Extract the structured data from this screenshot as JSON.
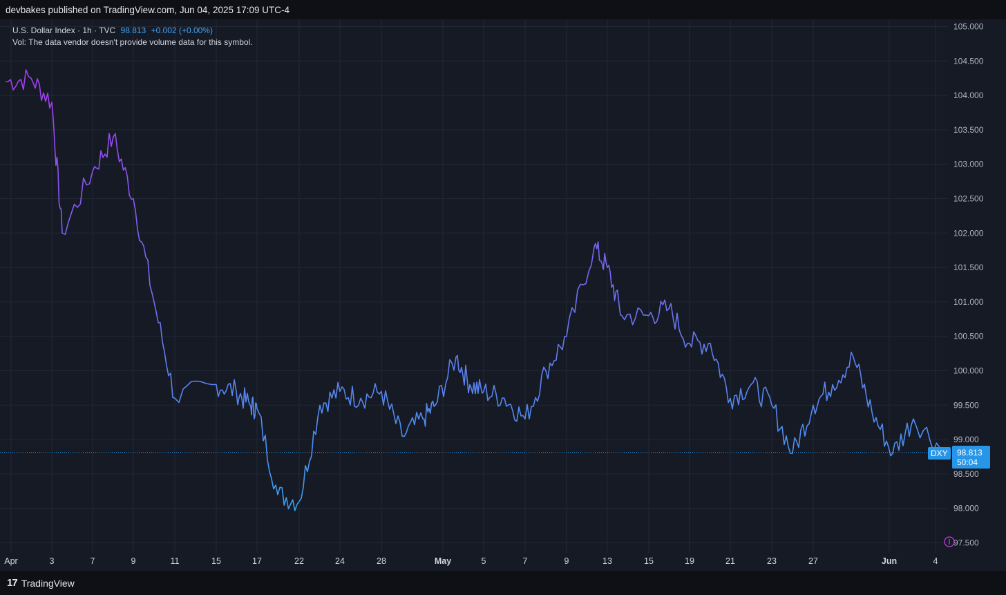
{
  "header": {
    "publisher": "devbakes published on TradingView.com, Jun 04, 2025 17:09 UTC-4"
  },
  "legend": {
    "symbol_line": "U.S. Dollar Index · 1h · TVC",
    "last_price": "98.813",
    "change": "+0.002 (+0.00%)",
    "volume_note": "Vol: The data vendor doesn't provide volume data for this symbol."
  },
  "price_tag": {
    "symbol": "DXY",
    "price": "98.813",
    "countdown": "50:04"
  },
  "footer": {
    "brand": "TradingView"
  },
  "colors": {
    "background": "#161a25",
    "grid": "#232838",
    "line_start": "#a63bf0",
    "line_end": "#3aa0ef",
    "tag": "#2896e8"
  },
  "chart_data": {
    "type": "line",
    "title": "U.S. Dollar Index · 1h · TVC",
    "y_ticks": [
      "105.000",
      "104.500",
      "104.000",
      "103.500",
      "103.000",
      "102.500",
      "102.000",
      "101.500",
      "101.000",
      "100.500",
      "100.000",
      "99.500",
      "99.000",
      "98.500",
      "98.000",
      "97.500"
    ],
    "x_ticks": [
      "Apr",
      "3",
      "7",
      "9",
      "11",
      "15",
      "17",
      "22",
      "24",
      "28",
      "May",
      "5",
      "7",
      "9",
      "13",
      "15",
      "19",
      "21",
      "23",
      "27",
      "Jun",
      "4"
    ],
    "ylim": [
      97.3,
      105.1
    ],
    "grid": true,
    "current_price": 98.813,
    "series": [
      {
        "name": "DXY",
        "x": [
          "Apr 1",
          "Apr 2",
          "Apr 3",
          "Apr 4",
          "Apr 7",
          "Apr 8",
          "Apr 9",
          "Apr 10",
          "Apr 11",
          "Apr 14",
          "Apr 15",
          "Apr 16",
          "Apr 17",
          "Apr 18",
          "Apr 21",
          "Apr 22",
          "Apr 23",
          "Apr 24",
          "Apr 25",
          "Apr 28",
          "Apr 29",
          "Apr 30",
          "May 1",
          "May 2",
          "May 5",
          "May 6",
          "May 7",
          "May 8",
          "May 9",
          "May 12",
          "May 13",
          "May 14",
          "May 15",
          "May 16",
          "May 19",
          "May 20",
          "May 21",
          "May 22",
          "May 23",
          "May 26",
          "May 27",
          "May 28",
          "May 29",
          "May 30",
          "Jun 2",
          "Jun 3",
          "Jun 4"
        ],
        "values": [
          104.2,
          104.25,
          103.9,
          102.0,
          102.9,
          103.4,
          102.5,
          101.0,
          99.6,
          99.8,
          99.7,
          99.5,
          99.45,
          98.2,
          98.1,
          99.5,
          99.7,
          99.6,
          99.7,
          99.05,
          99.3,
          99.5,
          100.2,
          99.8,
          99.7,
          99.6,
          99.3,
          100.0,
          100.5,
          101.8,
          101.5,
          100.8,
          100.8,
          100.9,
          100.4,
          100.4,
          99.6,
          99.8,
          99.5,
          98.8,
          99.5,
          99.8,
          100.2,
          99.4,
          98.8,
          99.3,
          98.8
        ]
      }
    ]
  }
}
